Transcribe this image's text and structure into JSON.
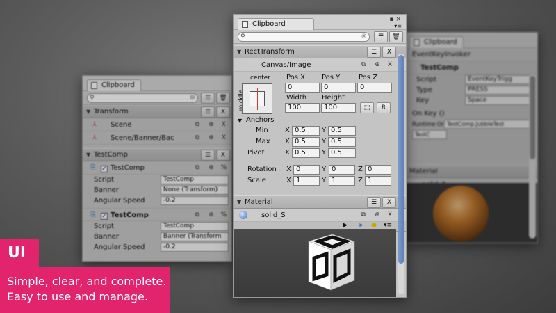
{
  "left_window": {
    "tab_label": "Clipboard",
    "sections": [
      {
        "header": "Transform",
        "rows": [
          {
            "label": "Scene"
          },
          {
            "label": "Scene/Banner/Bac"
          }
        ]
      },
      {
        "header": "TestComp",
        "components": [
          {
            "title": "TestComp",
            "bold": false,
            "props": [
              {
                "key": "Script",
                "value": "TestComp"
              },
              {
                "key": "Banner",
                "value": "None (Transform)"
              },
              {
                "key": "Angular Speed",
                "value": "-0.2"
              }
            ]
          },
          {
            "title": "TestComp",
            "bold": true,
            "props": [
              {
                "key": "Script",
                "value": "TestComp"
              },
              {
                "key": "Banner",
                "value": "Banner (Transform"
              },
              {
                "key": "Angular Speed",
                "value": "-0.2"
              }
            ]
          }
        ]
      }
    ]
  },
  "main_window": {
    "tab_label": "Clipboard",
    "rect_section": {
      "header": "RectTransform",
      "item_label": "Canvas/Image",
      "anchor_preset": {
        "top": "center",
        "side": "middle"
      },
      "pos_labels": [
        "Pos X",
        "Pos Y",
        "Pos Z"
      ],
      "pos_values": [
        "0",
        "0",
        "0"
      ],
      "size_labels": [
        "Width",
        "Height"
      ],
      "size_values": [
        "100",
        "100"
      ],
      "r_button": "R",
      "anchors_label": "Anchors",
      "min_label": "Min",
      "min": {
        "x": "0.5",
        "y": "0.5"
      },
      "max_label": "Max",
      "max": {
        "x": "0.5",
        "y": "0.5"
      },
      "pivot_label": "Pivot",
      "pivot": {
        "x": "0.5",
        "y": "0.5"
      },
      "rotation_label": "Rotation",
      "rotation": {
        "x": "0",
        "y": "0",
        "z": "0"
      },
      "scale_label": "Scale",
      "scale": {
        "x": "1",
        "y": "1",
        "z": "1"
      },
      "axis": {
        "x": "X",
        "y": "Y",
        "z": "Z"
      }
    },
    "material_section": {
      "header": "Material",
      "item_label": "solid_S"
    }
  },
  "right_window": {
    "tab_label": "Clipboard",
    "rows": [
      "EventKeyInvoker",
      "TestComp"
    ],
    "props": [
      {
        "key": "Script",
        "value": "EventKeyTrigg"
      },
      {
        "key": "Type",
        "value": "PRESS"
      },
      {
        "key": "Key",
        "value": "Space"
      }
    ],
    "onkey_label": "On Key ()",
    "runtime_label": "Runtime Or",
    "runtime_value": "TestComp.JubbleTest",
    "testc_value": "TestC",
    "material_header": "Material",
    "material_item": "solid_2"
  },
  "promo": {
    "badge": "UI",
    "line1": "Simple, clear, and complete.",
    "line2": "Easy to use and manage."
  },
  "colors": {
    "accent": "#e1246b",
    "scroll_thumb": "#5c80b8"
  }
}
